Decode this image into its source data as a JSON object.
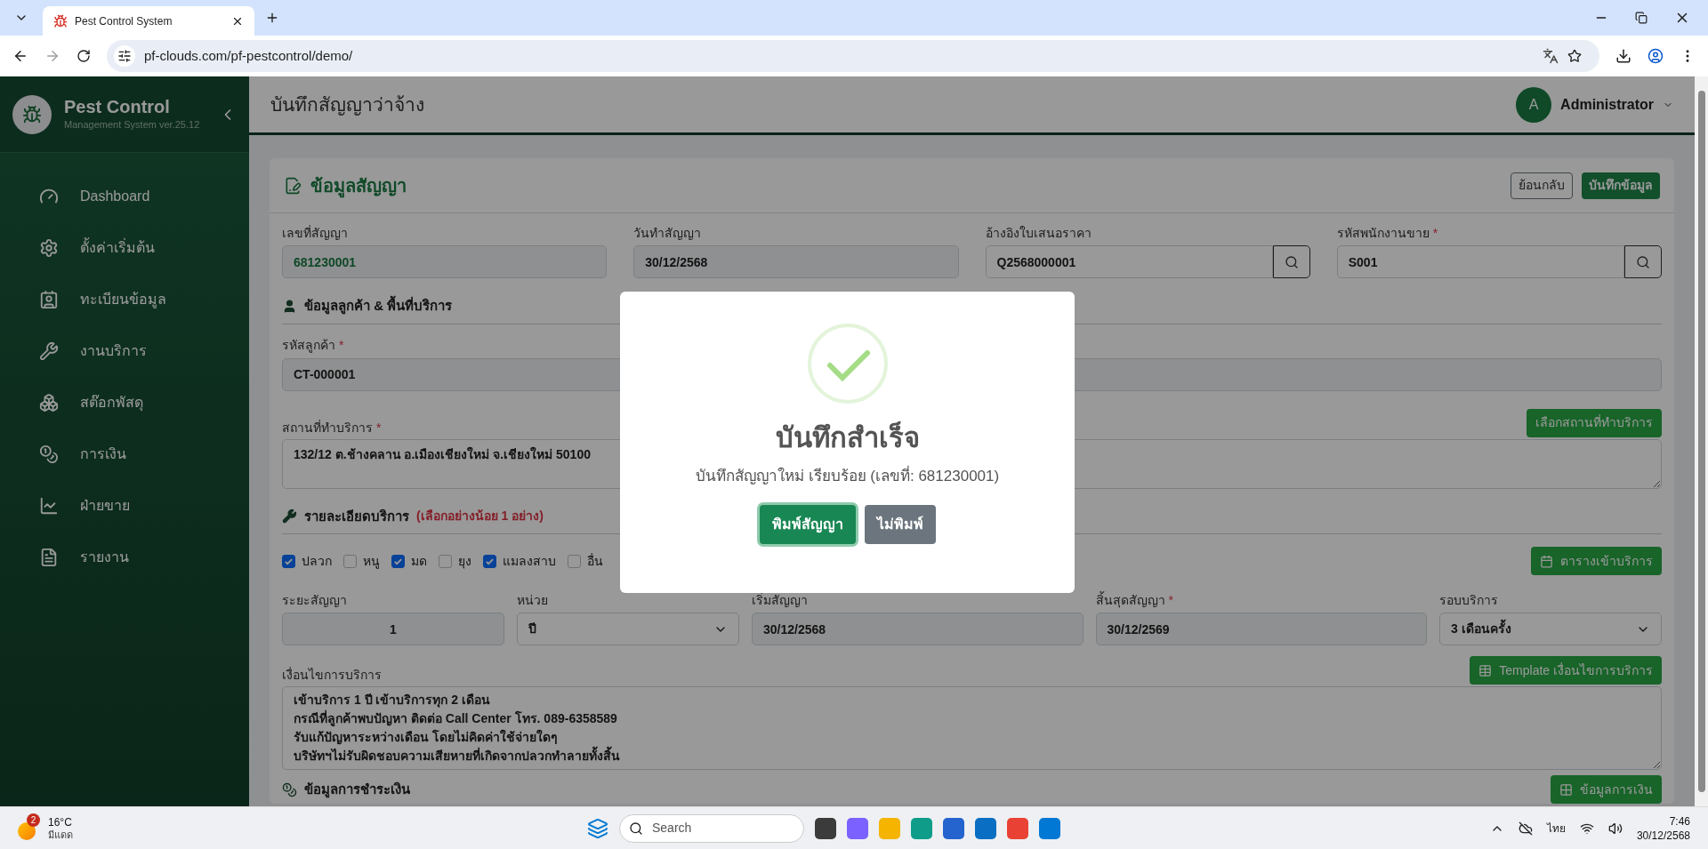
{
  "browser": {
    "tab_title": "Pest Control System",
    "url": "pf-clouds.com/pf-pestcontrol/demo/"
  },
  "sidebar": {
    "brand": "Pest Control",
    "subtitle": "Management System ver.25.12",
    "items": [
      {
        "label": "Dashboard"
      },
      {
        "label": "ตั้งค่าเริ่มต้น"
      },
      {
        "label": "ทะเบียนข้อมูล"
      },
      {
        "label": "งานบริการ"
      },
      {
        "label": "สต๊อกพัสดุ"
      },
      {
        "label": "การเงิน"
      },
      {
        "label": "ฝ่ายขาย"
      },
      {
        "label": "รายงาน"
      }
    ]
  },
  "header": {
    "title": "บันทึกสัญญาว่าจ้าง",
    "user_initial": "A",
    "user_name": "Administrator"
  },
  "card": {
    "title": "ข้อมูลสัญญา",
    "buttons": [
      {
        "label": "ย้อนกลับ",
        "kind": "outline"
      },
      {
        "label": "บันทึกข้อมูล",
        "kind": "primary"
      }
    ],
    "contract_fields": [
      {
        "label": "เลขที่สัญญา",
        "value": "681230001",
        "highlighted": true,
        "lookup": false
      },
      {
        "label": "วันทำสัญญา",
        "value": "30/12/2568",
        "highlighted": false,
        "lookup": false
      },
      {
        "label": "อ้างอิงใบเสนอราคา",
        "value": "Q2568000001",
        "highlighted": false,
        "lookup": true
      },
      {
        "label": "รหัสพนักงานขาย",
        "required_mark": "*",
        "value": "S001",
        "highlighted": false,
        "lookup": true
      }
    ],
    "customer": {
      "title": "ข้อมูลลูกค้า & พื้นที่บริการ",
      "code_label": "รหัสลูกค้า",
      "code_required_mark": "*",
      "code_value": "CT-000001",
      "address_label": "สถานที่ทำบริการ",
      "address_required_mark": "*",
      "address_button": "เลือกสถานที่ทำบริการ",
      "address_value": "132/12 ต.ช้างคลาน อ.เมืองเชียงใหม่ จ.เชียงใหม่ 50100"
    },
    "service": {
      "title": "รายละเอียดบริการ",
      "note": "(เลือกอย่างน้อย 1 อย่าง)",
      "button": "ตารางเข้าบริการ",
      "options": [
        {
          "label": "ปลวก",
          "checked": true
        },
        {
          "label": "หนู",
          "checked": false
        },
        {
          "label": "มด",
          "checked": true
        },
        {
          "label": "ยุง",
          "checked": false
        },
        {
          "label": "แมลงสาบ",
          "checked": true
        },
        {
          "label": "อื่น",
          "checked": false
        }
      ]
    },
    "period_fields": [
      {
        "label": "ระยะสัญญา",
        "value": "1",
        "kind": "number"
      },
      {
        "label": "หน่วย",
        "value": "ปี",
        "kind": "select"
      },
      {
        "label": "เริ่มสัญญา",
        "value": "30/12/2568",
        "kind": "date"
      },
      {
        "label": "สิ้นสุดสัญญา",
        "required_mark": "*",
        "value": "30/12/2569",
        "kind": "date"
      },
      {
        "label": "รอบบริการ",
        "value": "3 เดือนครั้ง",
        "kind": "select"
      }
    ],
    "terms": {
      "label": "เงื่อนไขการบริการ",
      "button": "Template เงื่อนไขการบริการ",
      "lines": [
        "เข้าบริการ 1 ปี เข้าบริการทุก 2 เดือน",
        "กรณีที่ลูกค้าพบปัญหา ติดต่อ Call Center โทร. 089-6358589",
        "รับแก้ปัญหาระหว่างเดือน โดยไม่คิดค่าใช้จ่ายใดๆ",
        "บริษัทฯไม่รับผิดชอบความเสียหายที่เกิดจากปลวกทำลายทั้งสิ้น"
      ]
    },
    "payment": {
      "title": "ข้อมูลการชำระเงิน",
      "button": "ข้อมูลการเงิน"
    }
  },
  "dialog": {
    "title": "บันทึกสำเร็จ",
    "message": "บันทึกสัญญาใหม่ เรียบร้อย (เลขที่: 681230001)",
    "buttons": [
      {
        "label": "พิมพ์สัญญา",
        "kind": "confirm"
      },
      {
        "label": "ไม่พิมพ์",
        "kind": "cancel"
      }
    ]
  },
  "taskbar": {
    "weather_badge": "2",
    "temperature": "16°C",
    "condition": "มีแดด",
    "search_placeholder": "Search",
    "language": "ไทย",
    "time": "7:46",
    "date": "30/12/2568"
  }
}
